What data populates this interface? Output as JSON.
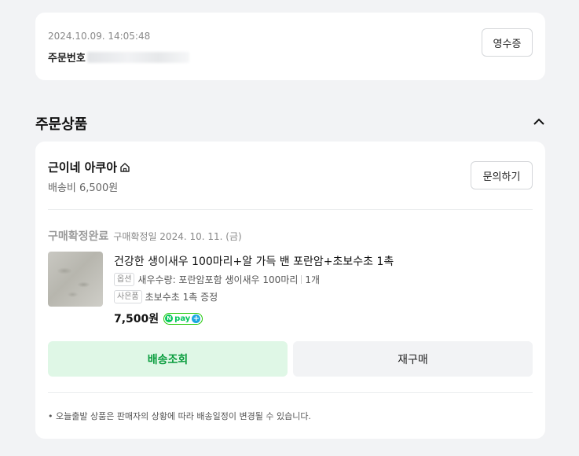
{
  "order": {
    "datetime": "2024.10.09. 14:05:48",
    "number_label": "주문번호",
    "receipt_button": "영수증"
  },
  "section": {
    "title": "주문상품"
  },
  "store": {
    "name": "근이네 아쿠아",
    "shipping_fee": "배송비 6,500원",
    "inquiry_button": "문의하기"
  },
  "item": {
    "status": "구매확정완료",
    "status_date": "구매확정일 2024. 10. 11. (금)",
    "title": "건강한 생이새우 100마리+알 가득 밴 포란암+초보수초 1촉",
    "option_tag": "옵션",
    "option_text": "새우수량: 포란암포함 생이새우 100마리",
    "quantity": "1개",
    "gift_tag": "사은품",
    "gift_text": "초보수초 1촉 증정",
    "price": "7,500원",
    "pay_badge": "pay"
  },
  "actions": {
    "track_button": "배송조회",
    "rebuy_button": "재구매"
  },
  "notice": "• 오늘출발 상품은 판매자의 상황에 따라 배송일정이 변경될 수 있습니다.",
  "colors": {
    "accent_green": "#0a9d3e",
    "track_bg": "#dff7e6",
    "npay_green": "#03c75a"
  }
}
